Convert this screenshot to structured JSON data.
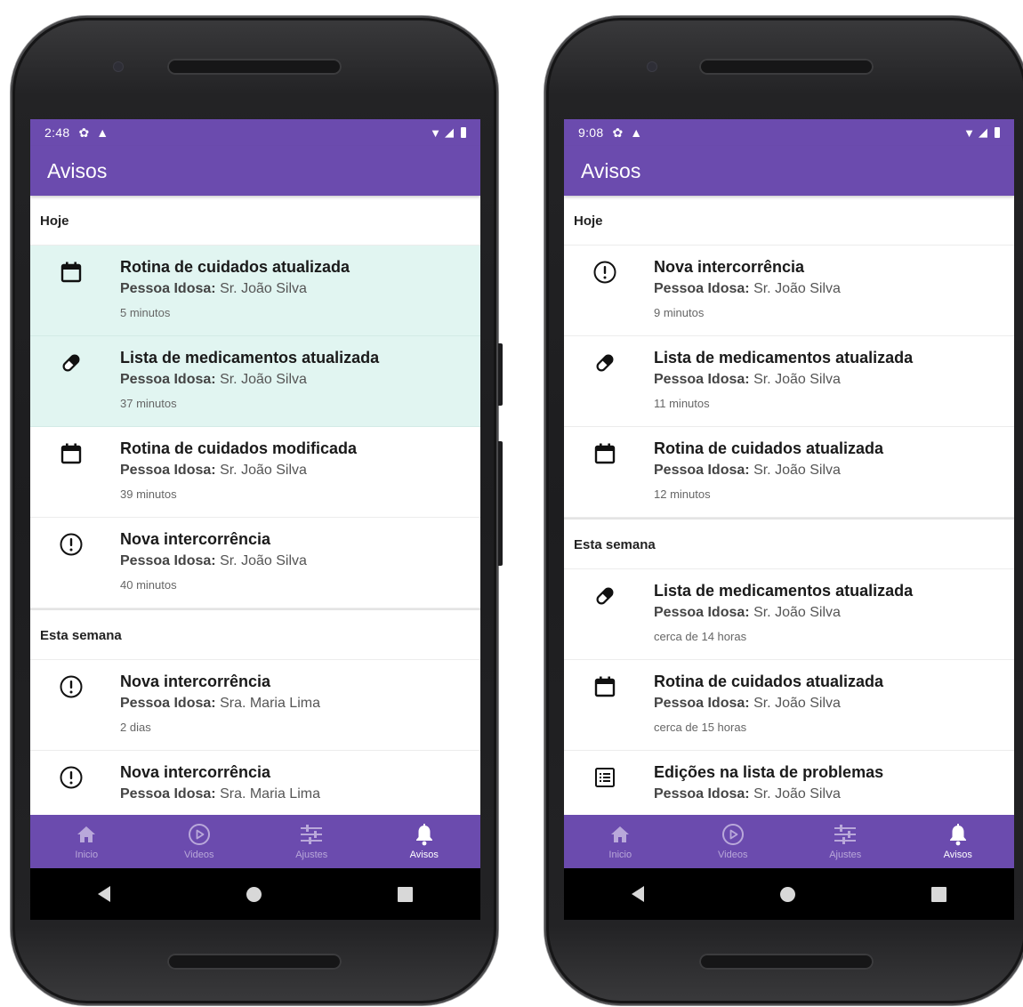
{
  "screens": [
    {
      "status_time": "2:48",
      "app_title": "Avisos",
      "sections": [
        {
          "header": "Hoje",
          "items": [
            {
              "icon": "calendar-icon",
              "title": "Rotina de cuidados atualizada",
              "label": "Pessoa Idosa:",
              "person": "Sr. João Silva",
              "time": "5 minutos",
              "highlight": true
            },
            {
              "icon": "pill-icon",
              "title": "Lista de medicamentos atualizada",
              "label": "Pessoa Idosa:",
              "person": "Sr. João Silva",
              "time": "37 minutos",
              "highlight": true
            },
            {
              "icon": "calendar-icon",
              "title": "Rotina de cuidados modificada",
              "label": "Pessoa Idosa:",
              "person": "Sr. João Silva",
              "time": "39 minutos",
              "highlight": false
            },
            {
              "icon": "alert-circle-icon",
              "title": "Nova intercorrência",
              "label": "Pessoa Idosa:",
              "person": "Sr. João Silva",
              "time": "40 minutos",
              "highlight": false
            }
          ]
        },
        {
          "header": "Esta semana",
          "items": [
            {
              "icon": "alert-circle-icon",
              "title": "Nova intercorrência",
              "label": "Pessoa Idosa:",
              "person": "Sra. Maria Lima",
              "time": "2 dias",
              "highlight": false
            },
            {
              "icon": "alert-circle-icon",
              "title": "Nova intercorrência",
              "label": "Pessoa Idosa:",
              "person": "Sra. Maria Lima",
              "time": "",
              "highlight": false
            }
          ]
        }
      ]
    },
    {
      "status_time": "9:08",
      "app_title": "Avisos",
      "sections": [
        {
          "header": "Hoje",
          "items": [
            {
              "icon": "alert-circle-icon",
              "title": "Nova intercorrência",
              "label": "Pessoa Idosa:",
              "person": "Sr. João Silva",
              "time": "9 minutos",
              "highlight": false
            },
            {
              "icon": "pill-icon",
              "title": "Lista de medicamentos atualizada",
              "label": "Pessoa Idosa:",
              "person": "Sr. João Silva",
              "time": "11 minutos",
              "highlight": false
            },
            {
              "icon": "calendar-icon",
              "title": "Rotina de cuidados atualizada",
              "label": "Pessoa Idosa:",
              "person": "Sr. João Silva",
              "time": "12 minutos",
              "highlight": false
            }
          ]
        },
        {
          "header": "Esta semana",
          "items": [
            {
              "icon": "pill-icon",
              "title": "Lista de medicamentos atualizada",
              "label": "Pessoa Idosa:",
              "person": "Sr. João Silva",
              "time": "cerca de 14 horas",
              "highlight": false
            },
            {
              "icon": "calendar-icon",
              "title": "Rotina de cuidados atualizada",
              "label": "Pessoa Idosa:",
              "person": "Sr. João Silva",
              "time": "cerca de 15 horas",
              "highlight": false
            },
            {
              "icon": "list-icon",
              "title": "Edições na lista de problemas",
              "label": "Pessoa Idosa:",
              "person": "Sr. João Silva",
              "time": "",
              "highlight": false
            }
          ]
        }
      ]
    }
  ],
  "bottom_nav": [
    {
      "icon": "home-icon",
      "label": "Inicio",
      "active": false
    },
    {
      "icon": "play-circle-icon",
      "label": "Videos",
      "active": false
    },
    {
      "icon": "sliders-icon",
      "label": "Ajustes",
      "active": false
    },
    {
      "icon": "bell-icon",
      "label": "Avisos",
      "active": true
    }
  ],
  "colors": {
    "primary": "#6b4bae",
    "highlight": "#e1f5f1",
    "nav_inactive": "#b9a8da"
  }
}
